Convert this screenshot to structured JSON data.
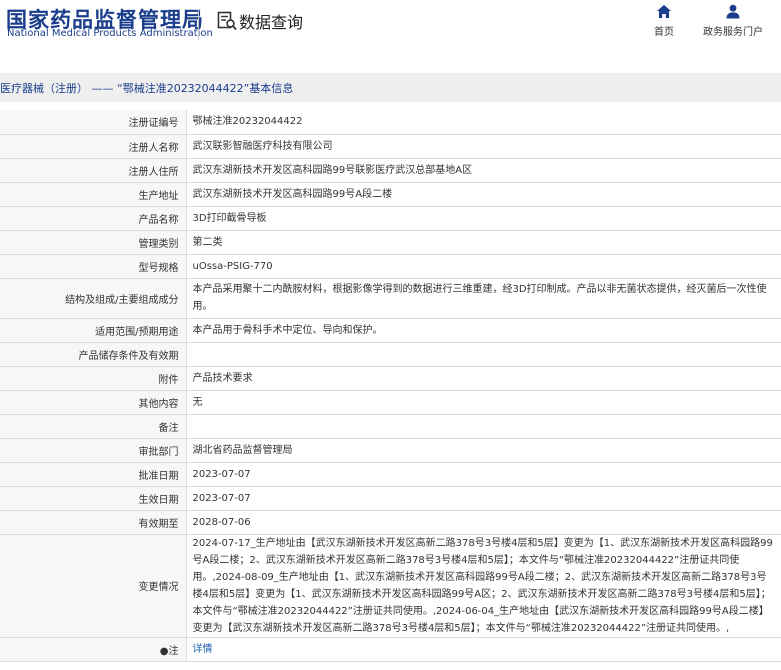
{
  "header": {
    "logo_cn": "国家药品监督管理局",
    "logo_en": "National Medical Products Administration",
    "query_label": "数据查询",
    "nav": [
      {
        "label": "首页",
        "icon": "home-icon"
      },
      {
        "label": "政务服务门户",
        "icon": "user-icon"
      }
    ]
  },
  "breadcrumb": "医疗器械（注册） —— “鄂械注准20232044422”基本信息",
  "rows": [
    {
      "label": "注册证编号",
      "value": "鄂械注准20232044422"
    },
    {
      "label": "注册人名称",
      "value": "武汉联影智融医疗科技有限公司"
    },
    {
      "label": "注册人住所",
      "value": "武汉东湖新技术开发区高科园路99号联影医疗武汉总部基地A区"
    },
    {
      "label": "生产地址",
      "value": "武汉东湖新技术开发区高科园路99号A段二楼"
    },
    {
      "label": "产品名称",
      "value": "3D打印截骨导板"
    },
    {
      "label": "管理类别",
      "value": "第二类"
    },
    {
      "label": "型号规格",
      "value": "uOssa-PSIG-770"
    },
    {
      "label": "结构及组成/主要组成成分",
      "value": "本产品采用聚十二内酰胺材料，根据影像学得到的数据进行三维重建，经3D打印制成。产品以非无菌状态提供，经灭菌后一次性使用。"
    },
    {
      "label": "适用范围/预期用途",
      "value": "本产品用于骨科手术中定位、导向和保护。"
    },
    {
      "label": "产品储存条件及有效期",
      "value": ""
    },
    {
      "label": "附件",
      "value": "产品技术要求"
    },
    {
      "label": "其他内容",
      "value": "无"
    },
    {
      "label": "备注",
      "value": ""
    },
    {
      "label": "审批部门",
      "value": "湖北省药品监督管理局"
    },
    {
      "label": "批准日期",
      "value": "2023-07-07"
    },
    {
      "label": "生效日期",
      "value": "2023-07-07"
    },
    {
      "label": "有效期至",
      "value": "2028-07-06"
    },
    {
      "label": "变更情况",
      "value": "2024-07-17_生产地址由【武汉东湖新技术开发区高新二路378号3号楼4层和5层】变更为【1、武汉东湖新技术开发区高科园路99号A段二楼；2、武汉东湖新技术开发区高新二路378号3号楼4层和5层】；本文件与“鄂械注准20232044422”注册证共同使用。,2024-08-09_生产地址由【1、武汉东湖新技术开发区高科园路99号A段二楼；2、武汉东湖新技术开发区高新二路378号3号楼4层和5层】变更为【1、武汉东湖新技术开发区高科园路99号A区；2、武汉东湖新技术开发区高新二路378号3号楼4层和5层】；本文件与“鄂械注准20232044422”注册证共同使用。,2024-06-04_生产地址由【武汉东湖新技术开发区高科园路99号A段二楼】变更为【武汉东湖新技术开发区高新二路378号3号楼4层和5层】；本文件与“鄂械注准20232044422”注册证共同使用。,"
    }
  ],
  "note_row": {
    "label": "注",
    "link": "详情"
  }
}
